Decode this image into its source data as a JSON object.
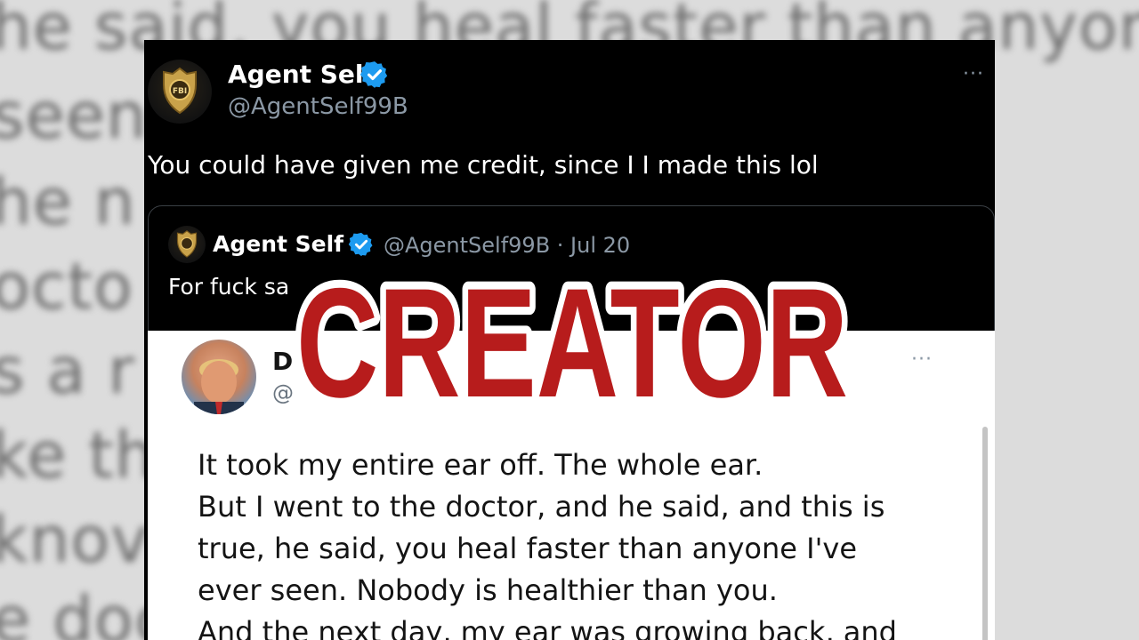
{
  "background_lines": [
    "he said, you heal faster than anyone",
    "seen.                                                     you.",
    "he n                                                  back",
    "octo                                                    like t",
    "s a r                                                  owing",
    "ke tha",
    "knov                                                     saying",
    "e doc                                                   ust, y"
  ],
  "tweet": {
    "author_name": "Agent Self",
    "author_handle": "@AgentSelf99B",
    "avatar_badge_text": "FBI",
    "text": "You could have given me credit, since I I made this lol",
    "more_label": "···"
  },
  "quoted": {
    "author_name": "Agent Self",
    "author_handle": "@AgentSelf99B · Jul 20",
    "text": "For fuck sa"
  },
  "embedded": {
    "author_initial": "D",
    "handle_initial": "@",
    "more_label": "···",
    "lines": [
      "It took my entire ear off. The whole ear.",
      "But I went to the doctor, and he said, and this is",
      "true, he said, you heal faster than anyone I've",
      "ever seen. Nobody is healthier than you.",
      "And the next day, my ear was growing back, and"
    ]
  },
  "overlay": {
    "label": "CREATOR",
    "fill_color": "#b71c1c",
    "stroke_color": "#ffffff"
  },
  "colors": {
    "verified": "#1d9bf0",
    "panel_bg": "#000000",
    "handle": "#8b98a5"
  }
}
